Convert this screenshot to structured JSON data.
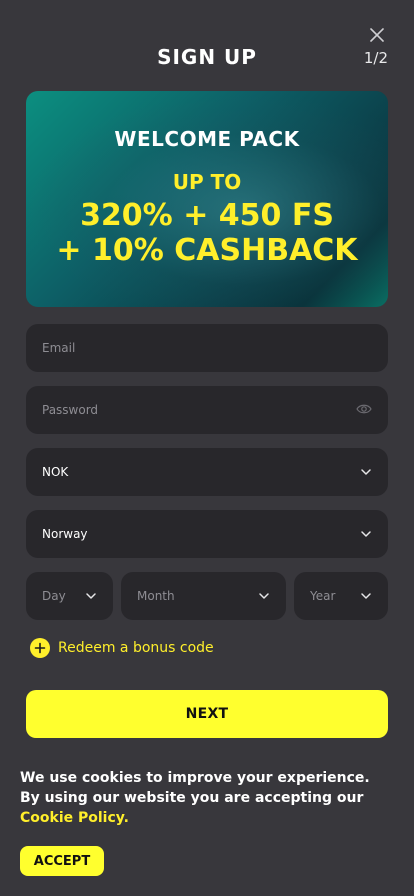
{
  "header": {
    "title": "SIGN UP",
    "step": "1/2"
  },
  "banner": {
    "line1": "WELCOME PACK",
    "line2": "UP TO",
    "line3": "320% + 450 FS",
    "line4": "+ 10% CASHBACK"
  },
  "form": {
    "email_placeholder": "Email",
    "password_placeholder": "Password",
    "currency_value": "NOK",
    "country_value": "Norway",
    "day_placeholder": "Day",
    "month_placeholder": "Month",
    "year_placeholder": "Year",
    "bonus_label": "Redeem a bonus code",
    "next_label": "NEXT"
  },
  "cookie": {
    "text": "We use cookies to improve your experience. By using our website you are accepting our",
    "link": "Cookie Policy.",
    "accept_label": "ACCEPT"
  },
  "colors": {
    "background": "#38373c",
    "field": "#28272b",
    "accent": "#ffff2e"
  },
  "icons": [
    "close-icon",
    "eye-icon",
    "chevron-down-icon",
    "plus-icon"
  ]
}
